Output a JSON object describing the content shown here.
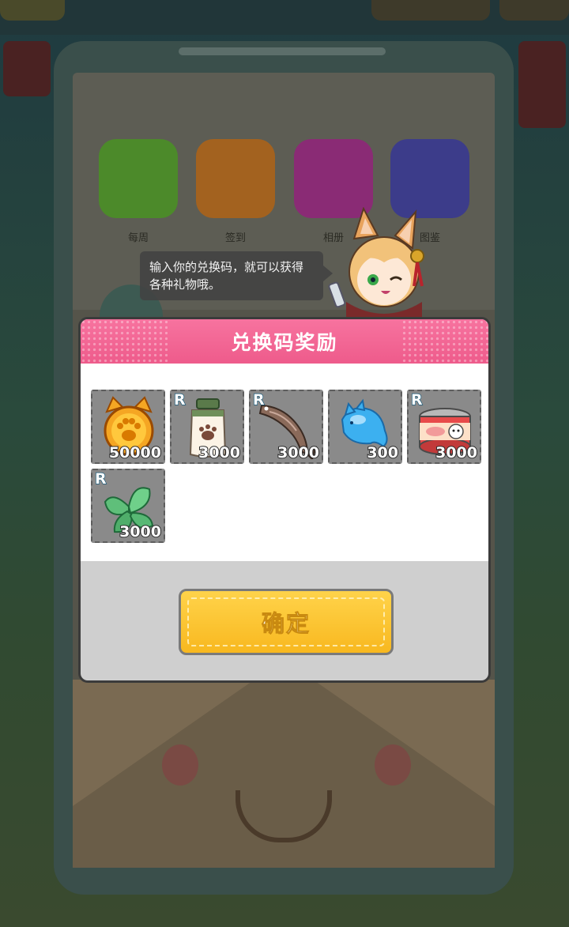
{
  "background": {
    "app_labels": [
      "每周",
      "签到",
      "相册",
      "图鉴"
    ]
  },
  "mascot": {
    "speech": "输入你的兑换码，就可以获得各种礼物哦。"
  },
  "dialog": {
    "title": "兑换码奖励",
    "confirm_label": "确定",
    "rewards": [
      {
        "icon": "cat-coin-icon",
        "rarity": "",
        "quantity": "50000"
      },
      {
        "icon": "milk-bottle-icon",
        "rarity": "R",
        "quantity": "3000"
      },
      {
        "icon": "dried-fish-icon",
        "rarity": "R",
        "quantity": "3000"
      },
      {
        "icon": "blue-fish-gem-icon",
        "rarity": "",
        "quantity": "300"
      },
      {
        "icon": "canned-food-icon",
        "rarity": "R",
        "quantity": "3000"
      },
      {
        "icon": "catnip-leaves-icon",
        "rarity": "R",
        "quantity": "3000"
      }
    ]
  },
  "colors": {
    "header_pink": "#ee5b8b",
    "button_yellow": "#f8b81f",
    "item_bg": "#8a8a8a"
  }
}
